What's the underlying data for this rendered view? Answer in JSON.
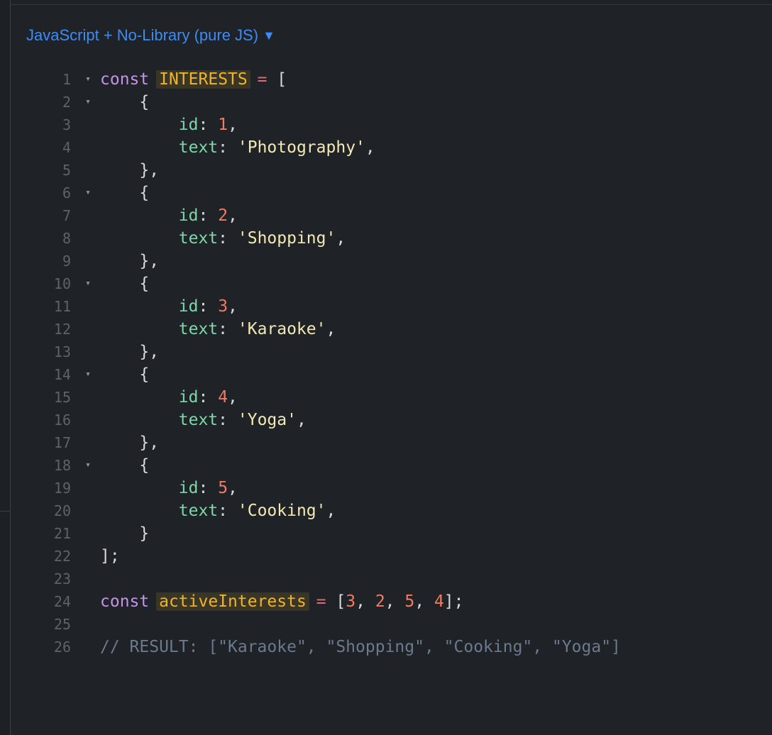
{
  "language_selector": {
    "label": "JavaScript + No-Library (pure JS)",
    "caret": "▼"
  },
  "editor": {
    "lines": [
      {
        "n": "1",
        "fold": true,
        "tokens": [
          [
            "kw",
            "const"
          ],
          [
            "punc",
            " "
          ],
          [
            "var",
            "INTERESTS"
          ],
          [
            "punc",
            " "
          ],
          [
            "op",
            "="
          ],
          [
            "punc",
            " ["
          ]
        ]
      },
      {
        "n": "2",
        "fold": true,
        "tokens": [
          [
            "punc",
            "    {"
          ]
        ]
      },
      {
        "n": "3",
        "fold": false,
        "tokens": [
          [
            "punc",
            "        "
          ],
          [
            "prop",
            "id"
          ],
          [
            "punc",
            ": "
          ],
          [
            "num",
            "1"
          ],
          [
            "punc",
            ","
          ]
        ]
      },
      {
        "n": "4",
        "fold": false,
        "tokens": [
          [
            "punc",
            "        "
          ],
          [
            "prop",
            "text"
          ],
          [
            "punc",
            ": "
          ],
          [
            "str",
            "'Photography'"
          ],
          [
            "punc",
            ","
          ]
        ]
      },
      {
        "n": "5",
        "fold": false,
        "tokens": [
          [
            "punc",
            "    },"
          ]
        ]
      },
      {
        "n": "6",
        "fold": true,
        "tokens": [
          [
            "punc",
            "    {"
          ]
        ]
      },
      {
        "n": "7",
        "fold": false,
        "tokens": [
          [
            "punc",
            "        "
          ],
          [
            "prop",
            "id"
          ],
          [
            "punc",
            ": "
          ],
          [
            "num",
            "2"
          ],
          [
            "punc",
            ","
          ]
        ]
      },
      {
        "n": "8",
        "fold": false,
        "tokens": [
          [
            "punc",
            "        "
          ],
          [
            "prop",
            "text"
          ],
          [
            "punc",
            ": "
          ],
          [
            "str",
            "'Shopping'"
          ],
          [
            "punc",
            ","
          ]
        ]
      },
      {
        "n": "9",
        "fold": false,
        "tokens": [
          [
            "punc",
            "    },"
          ]
        ]
      },
      {
        "n": "10",
        "fold": true,
        "tokens": [
          [
            "punc",
            "    {"
          ]
        ]
      },
      {
        "n": "11",
        "fold": false,
        "tokens": [
          [
            "punc",
            "        "
          ],
          [
            "prop",
            "id"
          ],
          [
            "punc",
            ": "
          ],
          [
            "num",
            "3"
          ],
          [
            "punc",
            ","
          ]
        ]
      },
      {
        "n": "12",
        "fold": false,
        "tokens": [
          [
            "punc",
            "        "
          ],
          [
            "prop",
            "text"
          ],
          [
            "punc",
            ": "
          ],
          [
            "str",
            "'Karaoke'"
          ],
          [
            "punc",
            ","
          ]
        ]
      },
      {
        "n": "13",
        "fold": false,
        "tokens": [
          [
            "punc",
            "    },"
          ]
        ]
      },
      {
        "n": "14",
        "fold": true,
        "tokens": [
          [
            "punc",
            "    {"
          ]
        ]
      },
      {
        "n": "15",
        "fold": false,
        "tokens": [
          [
            "punc",
            "        "
          ],
          [
            "prop",
            "id"
          ],
          [
            "punc",
            ": "
          ],
          [
            "num",
            "4"
          ],
          [
            "punc",
            ","
          ]
        ]
      },
      {
        "n": "16",
        "fold": false,
        "tokens": [
          [
            "punc",
            "        "
          ],
          [
            "prop",
            "text"
          ],
          [
            "punc",
            ": "
          ],
          [
            "str",
            "'Yoga'"
          ],
          [
            "punc",
            ","
          ]
        ]
      },
      {
        "n": "17",
        "fold": false,
        "tokens": [
          [
            "punc",
            "    },"
          ]
        ]
      },
      {
        "n": "18",
        "fold": true,
        "tokens": [
          [
            "punc",
            "    {"
          ]
        ]
      },
      {
        "n": "19",
        "fold": false,
        "tokens": [
          [
            "punc",
            "        "
          ],
          [
            "prop",
            "id"
          ],
          [
            "punc",
            ": "
          ],
          [
            "num",
            "5"
          ],
          [
            "punc",
            ","
          ]
        ]
      },
      {
        "n": "20",
        "fold": false,
        "tokens": [
          [
            "punc",
            "        "
          ],
          [
            "prop",
            "text"
          ],
          [
            "punc",
            ": "
          ],
          [
            "str",
            "'Cooking'"
          ],
          [
            "punc",
            ","
          ]
        ]
      },
      {
        "n": "21",
        "fold": false,
        "tokens": [
          [
            "punc",
            "    }"
          ]
        ]
      },
      {
        "n": "22",
        "fold": false,
        "tokens": [
          [
            "punc",
            "];"
          ]
        ]
      },
      {
        "n": "23",
        "fold": false,
        "tokens": []
      },
      {
        "n": "24",
        "fold": false,
        "tokens": [
          [
            "kw",
            "const"
          ],
          [
            "punc",
            " "
          ],
          [
            "var",
            "activeInterests"
          ],
          [
            "punc",
            " "
          ],
          [
            "op",
            "="
          ],
          [
            "punc",
            " ["
          ],
          [
            "num",
            "3"
          ],
          [
            "punc",
            ", "
          ],
          [
            "num",
            "2"
          ],
          [
            "punc",
            ", "
          ],
          [
            "num",
            "5"
          ],
          [
            "punc",
            ", "
          ],
          [
            "num",
            "4"
          ],
          [
            "punc",
            "];"
          ]
        ]
      },
      {
        "n": "25",
        "fold": false,
        "tokens": []
      },
      {
        "n": "26",
        "fold": false,
        "tokens": [
          [
            "cmt",
            "// RESULT: [\"Karaoke\", \"Shopping\", \"Cooking\", \"Yoga\"]"
          ]
        ]
      }
    ]
  },
  "icons": {
    "fold_arrow": "▾"
  }
}
